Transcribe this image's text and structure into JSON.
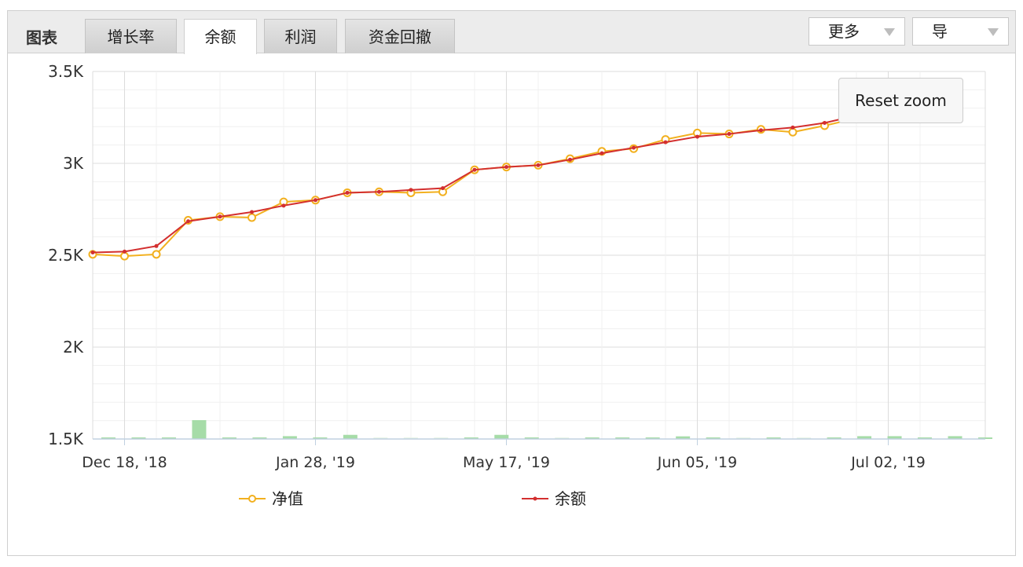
{
  "panel": {
    "title": "图表",
    "tabs": [
      {
        "label": "增长率",
        "active": false
      },
      {
        "label": "余额",
        "active": true
      },
      {
        "label": "利润",
        "active": false
      },
      {
        "label": "资金回撤",
        "active": false
      }
    ],
    "more_label": "更多",
    "export_label": "导"
  },
  "reset_zoom_label": "Reset zoom",
  "legend": [
    {
      "label": "净值"
    },
    {
      "label": "余额"
    }
  ],
  "colors": {
    "net_value": "#f2b01e",
    "balance": "#d32f2f",
    "volume": "#a6dca8",
    "grid": "#e6e6e6",
    "axis": "#c0d0e0"
  },
  "chart_data": {
    "type": "line",
    "title": "",
    "xlabel": "",
    "ylabel": "",
    "ylim": [
      1500,
      3500
    ],
    "yticks": [
      "1.5K",
      "2K",
      "2.5K",
      "3K",
      "3.5K"
    ],
    "xtick_labels": [
      {
        "label": "Dec 18, '18",
        "index": 1
      },
      {
        "label": "Jan 28, '19",
        "index": 7
      },
      {
        "label": "May 17, '19",
        "index": 13
      },
      {
        "label": "Jun 05, '19",
        "index": 19
      },
      {
        "label": "Jul 02, '19",
        "index": 25
      }
    ],
    "series": [
      {
        "name": "净值",
        "values": [
          2505,
          2495,
          2505,
          2690,
          2710,
          2705,
          2790,
          2800,
          2840,
          2845,
          2840,
          2845,
          2965,
          2980,
          2990,
          3025,
          3065,
          3080,
          3130,
          3165,
          3160,
          3185,
          3170,
          3205,
          3245,
          3290,
          3330,
          3375
        ]
      },
      {
        "name": "余额",
        "values": [
          2515,
          2520,
          2550,
          2685,
          2710,
          2735,
          2770,
          2800,
          2840,
          2845,
          2855,
          2865,
          2965,
          2980,
          2990,
          3020,
          3055,
          3085,
          3115,
          3145,
          3160,
          3180,
          3195,
          3220,
          3260,
          3295,
          3335,
          3370
        ]
      }
    ],
    "volume": [
      5,
      3,
      6,
      100,
      4,
      5,
      15,
      5,
      22,
      0,
      0,
      0,
      4,
      22,
      6,
      0,
      4,
      5,
      5,
      14,
      4,
      0,
      4,
      0,
      4,
      15,
      15,
      5,
      15,
      4
    ]
  }
}
